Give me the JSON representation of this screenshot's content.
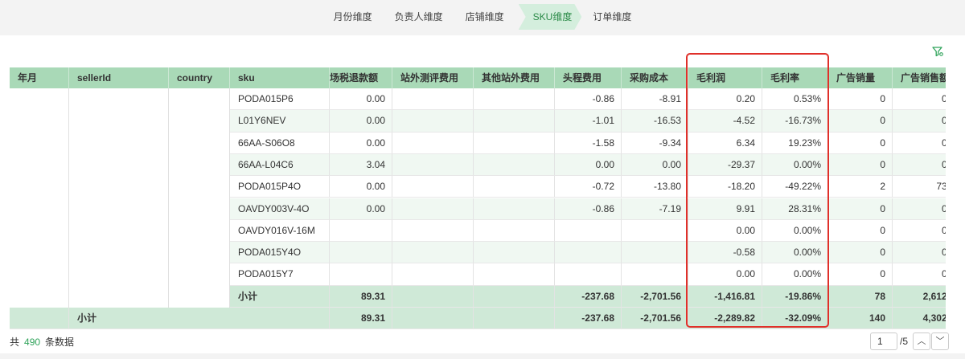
{
  "tabs": [
    {
      "label": "月份维度",
      "active": false
    },
    {
      "label": "负责人维度",
      "active": false
    },
    {
      "label": "店铺维度",
      "active": false
    },
    {
      "label": "SKU维度",
      "active": true
    },
    {
      "label": "订单维度",
      "active": false
    }
  ],
  "icons": {
    "filter": "filter-settings-icon",
    "prev": "chevron-up-icon",
    "next": "chevron-down-icon"
  },
  "colors": {
    "accent": "#2fa35a",
    "header": "#a9d9b7",
    "subtotal": "#cfe9d7",
    "highlight": "#e0302a"
  },
  "table": {
    "headers": [
      "年月",
      "sellerId",
      "country",
      "sku",
      "场税退款额",
      "站外测评费用",
      "其他站外费用",
      "头程费用",
      "采购成本",
      "毛利润",
      "毛利率",
      "广告销量",
      "广告销售额"
    ],
    "rows": [
      {
        "sku": "PODA015P6",
        "refund": "0.00",
        "offsite_review": "",
        "offsite_other": "",
        "first_leg": "-0.86",
        "purchase": "-8.91",
        "profit": "0.20",
        "margin": "0.53%",
        "ad_qty": "0",
        "ad_sales": "0."
      },
      {
        "sku": "L01Y6NEV",
        "refund": "0.00",
        "offsite_review": "",
        "offsite_other": "",
        "first_leg": "-1.01",
        "purchase": "-16.53",
        "profit": "-4.52",
        "margin": "-16.73%",
        "ad_qty": "0",
        "ad_sales": "0."
      },
      {
        "sku": "66AA-S06O8",
        "refund": "0.00",
        "offsite_review": "",
        "offsite_other": "",
        "first_leg": "-1.58",
        "purchase": "-9.34",
        "profit": "6.34",
        "margin": "19.23%",
        "ad_qty": "0",
        "ad_sales": "0."
      },
      {
        "sku": "66AA-L04C6",
        "refund": "3.04",
        "offsite_review": "",
        "offsite_other": "",
        "first_leg": "0.00",
        "purchase": "0.00",
        "profit": "-29.37",
        "margin": "0.00%",
        "ad_qty": "0",
        "ad_sales": "0."
      },
      {
        "sku": "PODA015P4O",
        "refund": "0.00",
        "offsite_review": "",
        "offsite_other": "",
        "first_leg": "-0.72",
        "purchase": "-13.80",
        "profit": "-18.20",
        "margin": "-49.22%",
        "ad_qty": "2",
        "ad_sales": "73."
      },
      {
        "sku": "OAVDY003V-4O",
        "refund": "0.00",
        "offsite_review": "",
        "offsite_other": "",
        "first_leg": "-0.86",
        "purchase": "-7.19",
        "profit": "9.91",
        "margin": "28.31%",
        "ad_qty": "0",
        "ad_sales": "0."
      },
      {
        "sku": "OAVDY016V-16M",
        "refund": "",
        "offsite_review": "",
        "offsite_other": "",
        "first_leg": "",
        "purchase": "",
        "profit": "0.00",
        "margin": "0.00%",
        "ad_qty": "0",
        "ad_sales": "0."
      },
      {
        "sku": "PODA015Y4O",
        "refund": "",
        "offsite_review": "",
        "offsite_other": "",
        "first_leg": "",
        "purchase": "",
        "profit": "-0.58",
        "margin": "0.00%",
        "ad_qty": "0",
        "ad_sales": "0."
      },
      {
        "sku": "PODA015Y7",
        "refund": "",
        "offsite_review": "",
        "offsite_other": "",
        "first_leg": "",
        "purchase": "",
        "profit": "0.00",
        "margin": "0.00%",
        "ad_qty": "0",
        "ad_sales": "0."
      }
    ],
    "subtotal": {
      "label": "小计",
      "refund": "89.31",
      "first_leg": "-237.68",
      "purchase": "-2,701.56",
      "profit": "-1,416.81",
      "margin": "-19.86%",
      "ad_qty": "78",
      "ad_sales": "2,612."
    },
    "total": {
      "label": "小计",
      "refund": "89.31",
      "first_leg": "-237.68",
      "purchase": "-2,701.56",
      "profit": "-2,289.82",
      "margin": "-32.09%",
      "ad_qty": "140",
      "ad_sales": "4,302."
    }
  },
  "footer": {
    "prefix": "共",
    "count": "490",
    "suffix": "条数据",
    "page": "1",
    "page_total": "/5"
  }
}
